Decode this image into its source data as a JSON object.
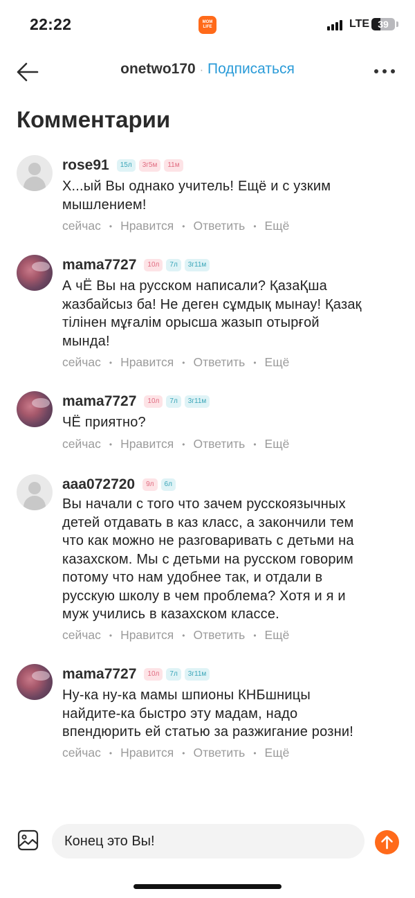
{
  "status_bar": {
    "time": "22:22",
    "app_icon_text": [
      "MOM",
      "LIFE"
    ],
    "network": "LTE",
    "battery": "39",
    "battery_level_percent": 39
  },
  "nav": {
    "username": "onetwo170",
    "separator": "·",
    "subscribe_label": "Подписаться"
  },
  "page_title": "Комментарии",
  "comments": [
    {
      "username": "rose91",
      "avatar": "default",
      "badges": [
        {
          "text": "15л",
          "color": "blue"
        },
        {
          "text": "3г5м",
          "color": "pink"
        },
        {
          "text": "11м",
          "color": "pink"
        }
      ],
      "lines": [
        "Х...ый Вы однако учитель! Ещё и с узким",
        "мышлением!"
      ],
      "time": "сейчас",
      "like": "Нравится",
      "reply": "Ответить",
      "more": "Ещё"
    },
    {
      "username": "mama7727",
      "avatar": "photo",
      "badges": [
        {
          "text": "10л",
          "color": "pink"
        },
        {
          "text": "7л",
          "color": "blue"
        },
        {
          "text": "3г11м",
          "color": "blue"
        }
      ],
      "lines": [
        "А чЁ Вы на русском написали? ҚазаҚша",
        "жазбайсыз ба! Не деген сұмдық мынау! Қазақ",
        "тілінен мұғалім орысша жазып отырғой",
        "мында!"
      ],
      "time": "сейчас",
      "like": "Нравится",
      "reply": "Ответить",
      "more": "Ещё"
    },
    {
      "username": "mama7727",
      "avatar": "photo",
      "badges": [
        {
          "text": "10л",
          "color": "pink"
        },
        {
          "text": "7л",
          "color": "blue"
        },
        {
          "text": "3г11м",
          "color": "blue"
        }
      ],
      "lines": [
        "ЧЁ приятно?"
      ],
      "time": "сейчас",
      "like": "Нравится",
      "reply": "Ответить",
      "more": "Ещё"
    },
    {
      "username": "aaa072720",
      "avatar": "default",
      "badges": [
        {
          "text": "9л",
          "color": "pink"
        },
        {
          "text": "6л",
          "color": "blue"
        }
      ],
      "lines": [
        "Вы начали с того что зачем русскоязычных",
        "детей отдавать в каз класс, а закончили тем",
        "что как можно не разговаривать с детьми на",
        "казахском. Мы с детьми на русском говорим",
        "потому что нам удобнее так, и отдали в",
        "русскую школу в чем проблема? Хотя и я и",
        "муж учились в казахском классе."
      ],
      "time": "сейчас",
      "like": "Нравится",
      "reply": "Ответить",
      "more": "Ещё"
    },
    {
      "username": "mama7727",
      "avatar": "photo",
      "badges": [
        {
          "text": "10л",
          "color": "pink"
        },
        {
          "text": "7л",
          "color": "blue"
        },
        {
          "text": "3г11м",
          "color": "blue"
        }
      ],
      "lines": [
        "Ну-ка ну-ка мамы шпионы КНБшницы",
        "найдите-ка быстро эту мадам, надо",
        "впендюрить ей статью за разжигание розни!"
      ],
      "time": "сейчас",
      "like": "Нравится",
      "reply": "Ответить",
      "more": "Ещё"
    }
  ],
  "composer": {
    "value": "Конец это Вы!"
  },
  "colors": {
    "accent": "#ff6a1a",
    "link": "#2a9bd8",
    "badge_blue": "#3aa5b8",
    "badge_pink": "#e06b80"
  }
}
